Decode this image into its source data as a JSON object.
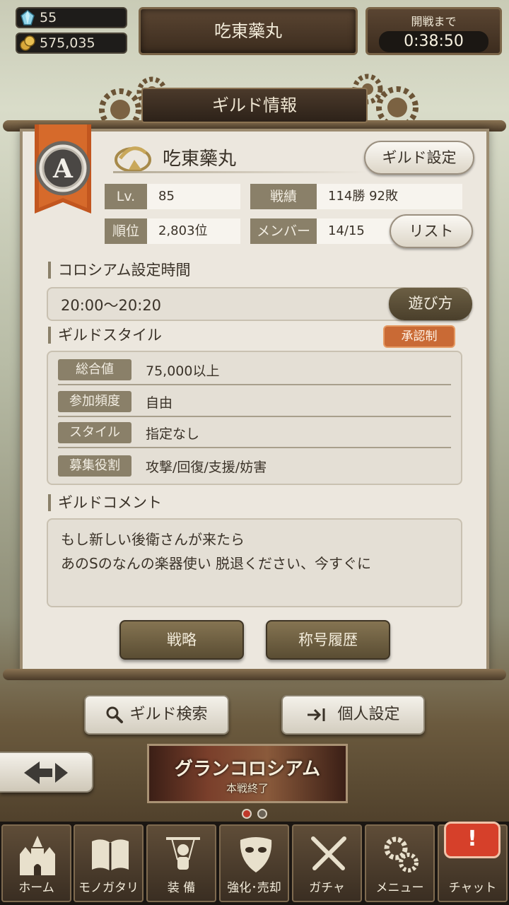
{
  "header": {
    "gems": "55",
    "gold": "575,035",
    "guild_name_banner": "吃東藥丸",
    "timer_label": "開戦まで",
    "timer_value": "0:38:50"
  },
  "panel": {
    "title": "ギルド情報",
    "rank": "A",
    "guild_name": "吃東藥丸",
    "settings_button": "ギルド設定",
    "stats": {
      "level_label": "Lv.",
      "level_value": "85",
      "record_label": "戦績",
      "record_value": "114勝 92敗",
      "rank_label": "順位",
      "rank_value": "2,803位",
      "members_label": "メンバー",
      "members_value": "14/15",
      "list_button": "リスト"
    },
    "colosseum": {
      "heading": "コロシアム設定時間",
      "time": "20:00〜20:20",
      "howto_button": "遊び方"
    },
    "style": {
      "heading": "ギルドスタイル",
      "badge": "承認制",
      "rows": [
        {
          "label": "総合値",
          "value": "75,000以上"
        },
        {
          "label": "参加頻度",
          "value": "自由"
        },
        {
          "label": "スタイル",
          "value": "指定なし"
        },
        {
          "label": "募集役割",
          "value": "攻撃/回復/支援/妨害"
        }
      ]
    },
    "comment": {
      "heading": "ギルドコメント",
      "line1": "もし新しい後衛さんが来たら",
      "line2": "あのSのなんの楽器使い 脱退ください、今すぐに"
    },
    "strategy_button": "戦略",
    "title_history_button": "称号履歴"
  },
  "actions": {
    "search_button": "ギルド検索",
    "personal_button": "個人設定"
  },
  "event": {
    "title": "グランコロシアム",
    "subtitle": "本戦終了"
  },
  "nav": {
    "items": [
      {
        "label": "ホーム",
        "icon": "castle-icon"
      },
      {
        "label": "モノガタリ",
        "icon": "book-icon"
      },
      {
        "label": "装 備",
        "icon": "puppet-icon"
      },
      {
        "label": "強化･売却",
        "icon": "mask-icon"
      },
      {
        "label": "ガチャ",
        "icon": "swords-icon"
      },
      {
        "label": "メニュー",
        "icon": "gears-icon"
      },
      {
        "label": "チャット",
        "icon": "chat-icon"
      }
    ],
    "chat_alert": "!"
  },
  "colors": {
    "accent_orange": "#c96a35",
    "panel_bg": "#ece7de",
    "label_bg": "#8a8069"
  }
}
